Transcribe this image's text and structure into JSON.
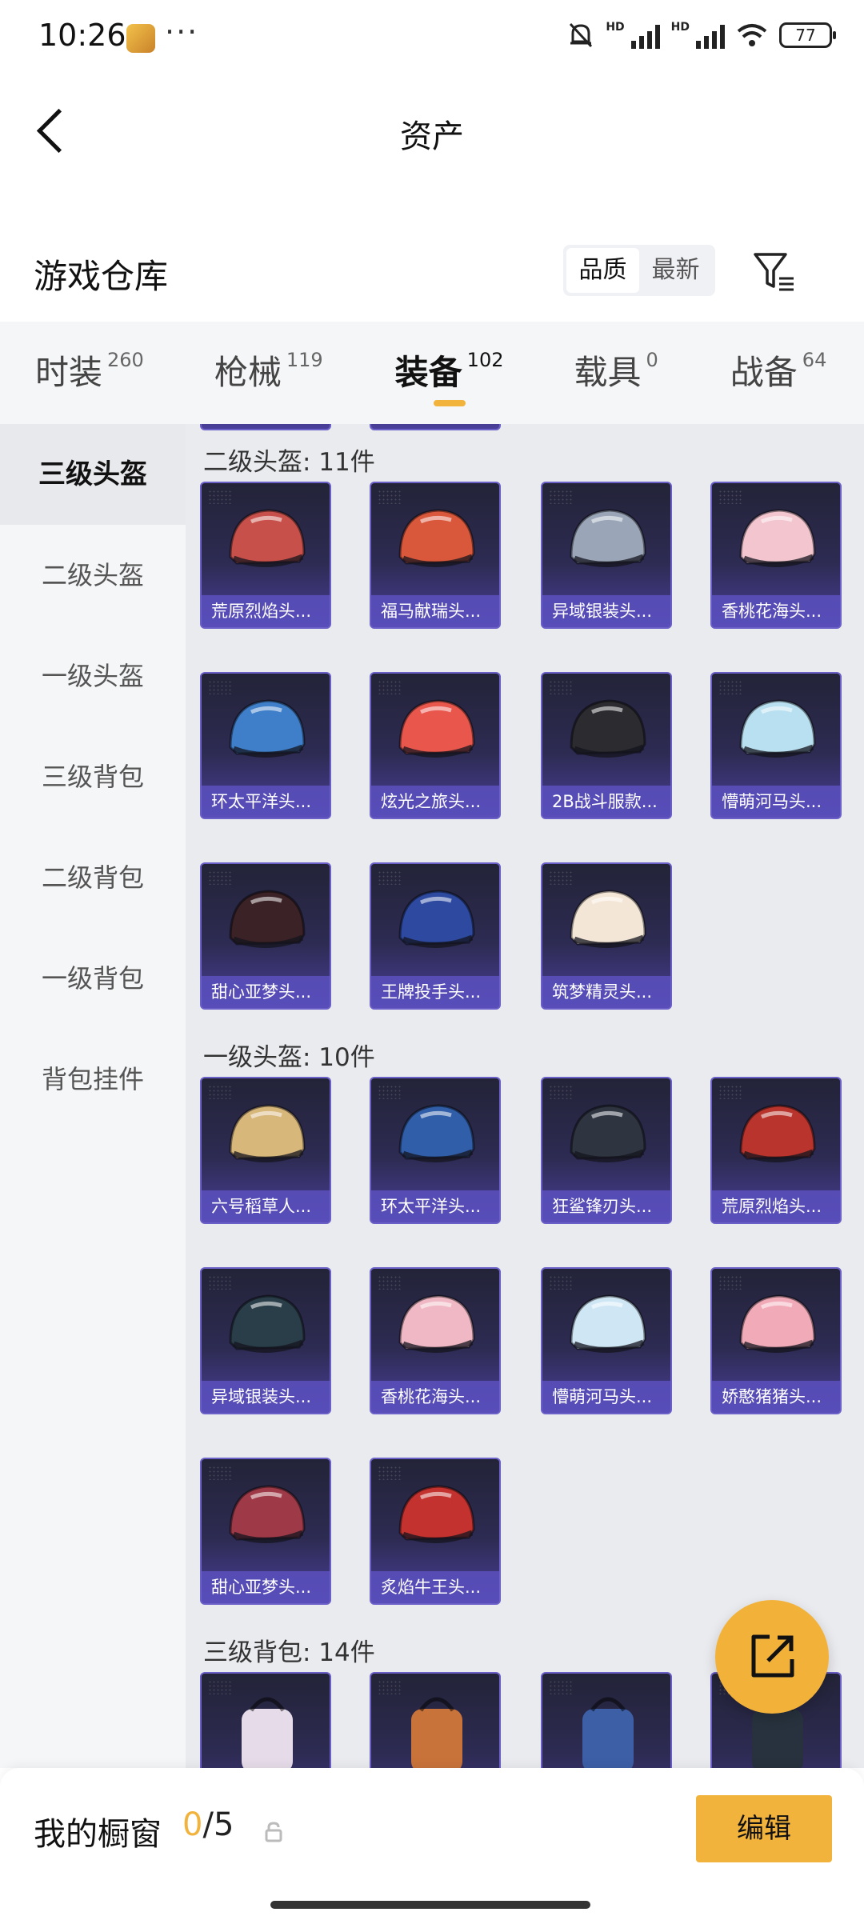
{
  "status_bar": {
    "time": "10:26",
    "more": "···",
    "battery": "77",
    "hd1": "HD",
    "hd2": "HD"
  },
  "header": {
    "title": "资产"
  },
  "warehouse": {
    "title": "游戏仓库",
    "sort_quality": "品质",
    "sort_latest": "最新"
  },
  "tabs": [
    {
      "label": "时装",
      "count": "260"
    },
    {
      "label": "枪械",
      "count": "119"
    },
    {
      "label": "装备",
      "count": "102"
    },
    {
      "label": "载具",
      "count": "0"
    },
    {
      "label": "战备",
      "count": "64"
    }
  ],
  "active_tab": "装备",
  "sidebar": [
    "三级头盔",
    "二级头盔",
    "一级头盔",
    "三级背包",
    "二级背包",
    "一级背包",
    "背包挂件"
  ],
  "sections": [
    {
      "title": "二级头盔: 11件",
      "items": [
        {
          "label": "荒原烈焰头...",
          "color": "#c8504a"
        },
        {
          "label": "福马献瑞头...",
          "color": "#d9573a"
        },
        {
          "label": "异域银装头...",
          "color": "#9aa6b8"
        },
        {
          "label": "香桃花海头...",
          "color": "#f2c5cf"
        },
        {
          "label": "环太平洋头...",
          "color": "#3f7fc9"
        },
        {
          "label": "炫光之旅头...",
          "color": "#e8564c"
        },
        {
          "label": "2B战斗服款...",
          "color": "#2b2b30"
        },
        {
          "label": "懵萌河马头...",
          "color": "#b9e0f0"
        },
        {
          "label": "甜心亚梦头...",
          "color": "#3a2226"
        },
        {
          "label": "王牌投手头...",
          "color": "#2d4aa0"
        },
        {
          "label": "筑梦精灵头...",
          "color": "#f4e6d6"
        }
      ]
    },
    {
      "title": "一级头盔: 10件",
      "items": [
        {
          "label": "六号稻草人...",
          "color": "#d7b77a"
        },
        {
          "label": "环太平洋头...",
          "color": "#315ea8"
        },
        {
          "label": "狂鲨锋刃头...",
          "color": "#2e3440"
        },
        {
          "label": "荒原烈焰头...",
          "color": "#b8342c"
        },
        {
          "label": "异域银装头...",
          "color": "#2a3e4a"
        },
        {
          "label": "香桃花海头...",
          "color": "#f0b8c4"
        },
        {
          "label": "懵萌河马头...",
          "color": "#cfe7f5"
        },
        {
          "label": "娇憨猪猪头...",
          "color": "#f1aab8"
        },
        {
          "label": "甜心亚梦头...",
          "color": "#9e3a48"
        },
        {
          "label": "炙焰牛王头...",
          "color": "#c3322e"
        }
      ]
    },
    {
      "title": "三级背包: 14件",
      "items": [
        {
          "label": "",
          "color": "#e6dbe8"
        },
        {
          "label": "",
          "color": "#c8733a"
        },
        {
          "label": "",
          "color": "#3d5fa6"
        },
        {
          "label": "",
          "color": "#27323e"
        }
      ]
    }
  ],
  "bottom": {
    "title": "我的橱窗",
    "current": "0",
    "sep": "/",
    "total": "5",
    "edit": "编辑"
  }
}
